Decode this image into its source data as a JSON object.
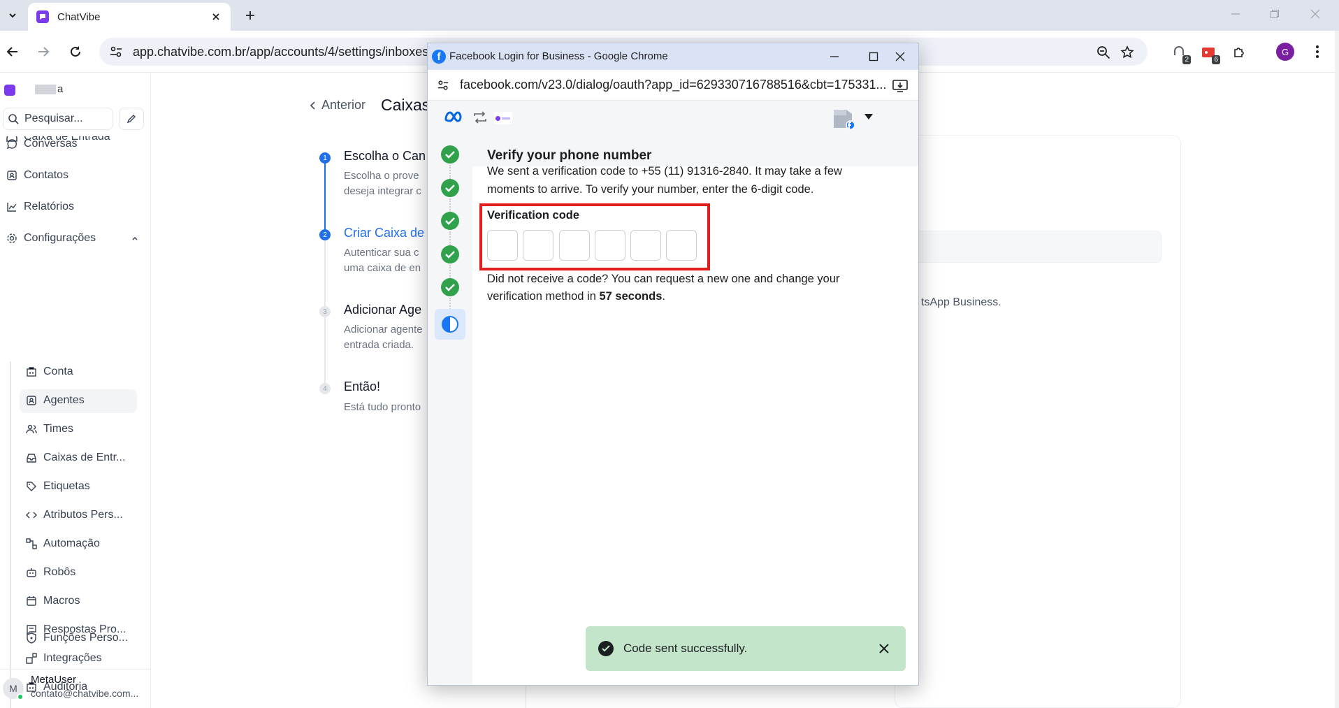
{
  "browser": {
    "tab": {
      "title": "ChatVibe"
    },
    "address_url": "app.chatvibe.com.br/app/accounts/4/settings/inboxes/",
    "extensions": [
      {
        "name": "extension-1",
        "badge": "2"
      },
      {
        "name": "extension-2",
        "badge": "6"
      }
    ],
    "profile_initial": "G"
  },
  "sidebar": {
    "account_name_suffix": "a",
    "search_placeholder": "Pesquisar...",
    "cut_item": "Caixa de Entrada",
    "items": [
      {
        "label": "Conversas"
      },
      {
        "label": "Contatos"
      },
      {
        "label": "Relatórios"
      },
      {
        "label": "Configurações"
      }
    ],
    "sub_items": [
      {
        "label": "Conta"
      },
      {
        "label": "Agentes"
      },
      {
        "label": "Times"
      },
      {
        "label": "Caixas de Entr..."
      },
      {
        "label": "Etiquetas"
      },
      {
        "label": "Atributos Pers..."
      },
      {
        "label": "Automação"
      },
      {
        "label": "Robôs"
      },
      {
        "label": "Macros"
      },
      {
        "label": "Respostas Pro..."
      },
      {
        "label": "Integrações"
      },
      {
        "label": "Auditoria"
      },
      {
        "label": "Funções Perso..."
      }
    ],
    "user": {
      "initial": "M",
      "name": "MetaUser",
      "email": "contato@chatvibe.com..."
    }
  },
  "main": {
    "back_label": "Anterior",
    "page_title": "Caixas",
    "steps": [
      {
        "num": "1",
        "title": "Escolha o Can",
        "desc": "Escolha o prove deseja integrar c"
      },
      {
        "num": "2",
        "title": "Criar Caixa de",
        "desc": "Autenticar sua c uma caixa de en"
      },
      {
        "num": "3",
        "title": "Adicionar Age",
        "desc": "Adicionar agente entrada criada."
      },
      {
        "num": "4",
        "title": "Então!",
        "desc": "Está tudo pronto"
      }
    ],
    "right_text": "tsApp Business."
  },
  "popup": {
    "window_title": "Facebook Login for Business - Google Chrome",
    "url": "facebook.com/v23.0/dialog/oauth?app_id=629330716788516&cbt=175331...",
    "heading": "Verify your phone number",
    "description": "We sent a verification code to +55 (11) 91316-2840. It may take a few moments to arrive. To verify your number, enter the 6-digit code.",
    "code_label": "Verification code",
    "code_digits": [
      "",
      "",
      "",
      "",
      "",
      ""
    ],
    "resend_prefix": "Did not receive a code? You can request a new one and change your verification method in ",
    "resend_time": "57 seconds",
    "resend_suffix": ".",
    "toast": "Code sent successfully."
  }
}
